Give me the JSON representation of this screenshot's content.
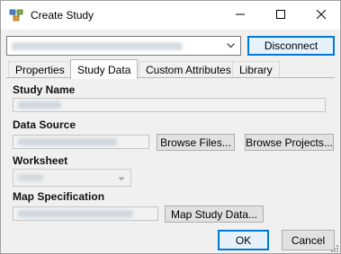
{
  "window": {
    "title": "Create Study",
    "controls": {
      "minimize": "minimize",
      "maximize": "maximize",
      "close": "close"
    }
  },
  "connection": {
    "disconnect_label": "Disconnect"
  },
  "tabs": [
    {
      "label": "Properties"
    },
    {
      "label": "Study Data"
    },
    {
      "label": "Custom Attributes"
    },
    {
      "label": "Library"
    }
  ],
  "form": {
    "study_name_label": "Study Name",
    "data_source_label": "Data Source",
    "browse_files_label": "Browse Files...",
    "browse_projects_label": "Browse Projects...",
    "worksheet_label": "Worksheet",
    "map_spec_label": "Map Specification",
    "map_study_data_label": "Map Study Data..."
  },
  "footer": {
    "ok_label": "OK",
    "cancel_label": "Cancel"
  },
  "colors": {
    "accent": "#0078d7",
    "window_bg": "#f0f0f0",
    "titlebar_bg": "#ffffff"
  },
  "icons": [
    "app-icon",
    "minimize-icon",
    "maximize-icon",
    "close-icon",
    "chevron-down-icon",
    "size-grip-icon"
  ]
}
